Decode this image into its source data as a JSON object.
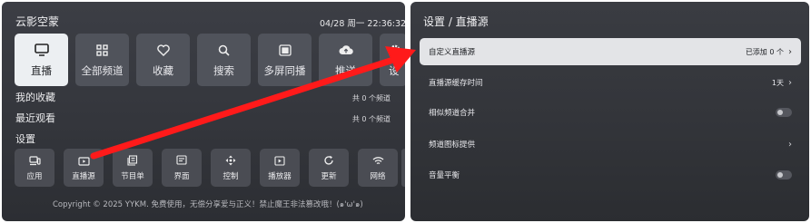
{
  "left": {
    "app_title": "云影空蒙",
    "datetime": "04/28 周一 22:36:32",
    "main_tiles": [
      {
        "label": "直播",
        "icon": "tv-icon"
      },
      {
        "label": "全部频道",
        "icon": "grid-icon"
      },
      {
        "label": "收藏",
        "icon": "heart-icon"
      },
      {
        "label": "搜索",
        "icon": "search-icon"
      },
      {
        "label": "多屏同播",
        "icon": "multiscreen-icon"
      },
      {
        "label": "推送",
        "icon": "cloud-upload-icon"
      },
      {
        "label": "设",
        "icon": "gear-icon"
      }
    ],
    "favorites": {
      "label": "我的收藏",
      "count": "共 0 个频道"
    },
    "recent": {
      "label": "最近观看",
      "count": "共 0 个频道"
    },
    "settings_label": "设置",
    "setting_tiles": [
      {
        "label": "应用",
        "icon": "device-icon"
      },
      {
        "label": "直播源",
        "icon": "live-source-icon"
      },
      {
        "label": "节目单",
        "icon": "schedule-icon"
      },
      {
        "label": "界面",
        "icon": "interface-icon"
      },
      {
        "label": "控制",
        "icon": "control-icon"
      },
      {
        "label": "播放器",
        "icon": "player-icon"
      },
      {
        "label": "更新",
        "icon": "update-icon"
      },
      {
        "label": "网络",
        "icon": "wifi-icon"
      }
    ],
    "footer": "Copyright © 2025 YYKM. 免费使用，无偿分享爱与正义！禁止魔王非法篡改哦！(๑'ω'๑)"
  },
  "right": {
    "title": "设置 / 直播源",
    "items": [
      {
        "name": "自定义直播源",
        "value": "已添加 0 个",
        "control": "chevron"
      },
      {
        "name": "直播源缓存时间",
        "value": "1天",
        "control": "chevron"
      },
      {
        "name": "相似频道合并",
        "value": "",
        "control": "toggle",
        "enabled": false
      },
      {
        "name": "频道图标提供",
        "value": "",
        "control": "chevron"
      },
      {
        "name": "音量平衡",
        "value": "",
        "control": "toggle",
        "enabled": false
      }
    ]
  },
  "colors": {
    "accent_arrow": "#ff1a1a",
    "tile": "#50535b",
    "active_tile": "#eceff2"
  }
}
